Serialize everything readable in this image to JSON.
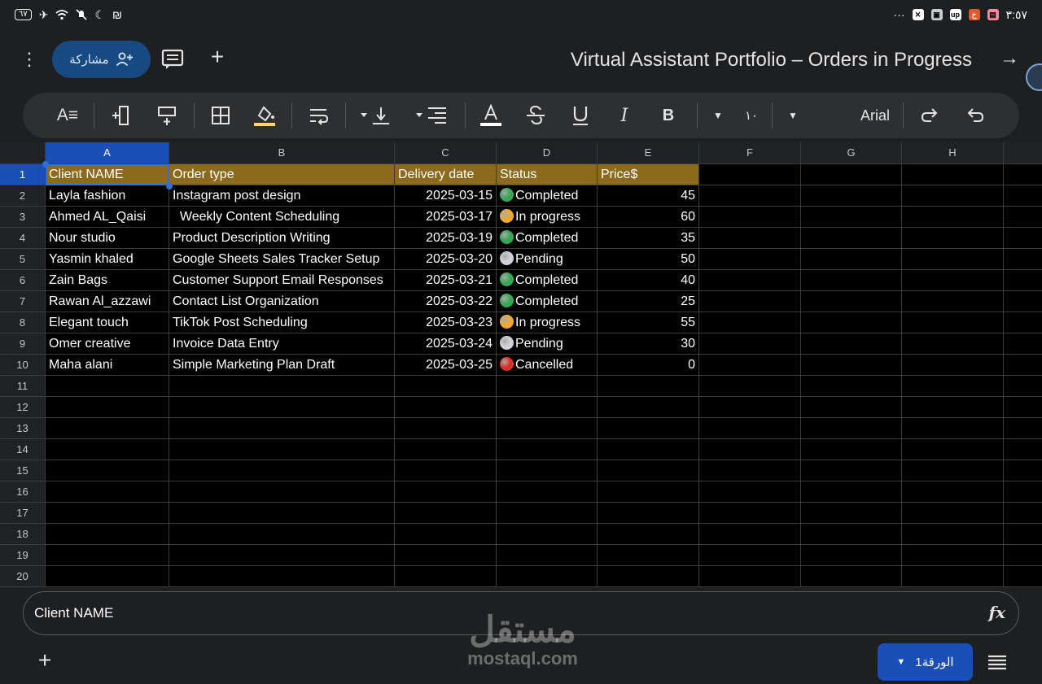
{
  "status_bar": {
    "time": "٣:٥٧",
    "battery": "٦٧",
    "more": "···"
  },
  "topbar": {
    "share_label": "مشاركة",
    "title": "Virtual Assistant Portfolio – Orders in Progress"
  },
  "toolbar": {
    "font_name": "Arial",
    "font_size": "١٠",
    "text_color_underline": "#ffffff",
    "fill_color_underline": "#fdd663"
  },
  "grid": {
    "columns": [
      "A",
      "B",
      "C",
      "D",
      "E",
      "F",
      "G",
      "H"
    ],
    "row_numbers": [
      "1",
      "2",
      "3",
      "4",
      "5",
      "6",
      "7",
      "8",
      "9",
      "10",
      "11",
      "12",
      "13",
      "14",
      "15",
      "16",
      "17",
      "18",
      "19",
      "20"
    ],
    "header": {
      "a": "Client NAME",
      "b": "Order type",
      "c": "Delivery date",
      "d": "Status",
      "e": "Price$"
    },
    "rows": [
      {
        "client": "Layla fashion",
        "order": "Instagram post design",
        "date": "2025-03-15",
        "status": "Completed",
        "price": "45"
      },
      {
        "client": "Ahmed AL_Qaisi",
        "order": "  Weekly Content Scheduling",
        "date": "2025-03-17",
        "status": "In progress",
        "price": "60"
      },
      {
        "client": "Nour studio",
        "order": "Product Description Writing",
        "date": "2025-03-19",
        "status": "Completed",
        "price": "35"
      },
      {
        "client": "Yasmin khaled",
        "order": "Google Sheets Sales Tracker Setup",
        "date": "2025-03-20",
        "status": "Pending",
        "price": "50"
      },
      {
        "client": "Zain Bags",
        "order": "Customer Support Email Responses",
        "date": "2025-03-21",
        "status": "Completed",
        "price": "40"
      },
      {
        "client": "Rawan Al_azzawi",
        "order": "Contact List Organization",
        "date": "2025-03-22",
        "status": "Completed",
        "price": "25"
      },
      {
        "client": "Elegant touch",
        "order": "TikTok Post Scheduling",
        "date": "2025-03-23",
        "status": "In progress",
        "price": "55"
      },
      {
        "client": "Omer creative",
        "order": "Invoice Data Entry",
        "date": "2025-03-24",
        "status": "Pending",
        "price": "30"
      },
      {
        "client": "Maha alani",
        "order": "Simple Marketing Plan Draft",
        "date": "2025-03-25",
        "status": "Cancelled",
        "price": "0"
      }
    ],
    "status_colors": {
      "Completed": "#34a853",
      "In progress": "#f0a830",
      "Pending": "#d0d0d8",
      "Cancelled": "#d93025"
    },
    "header_color": "#8b6a1c",
    "selection_color": "#1a4fb8"
  },
  "formula_bar": {
    "value": "Client NAME",
    "fx_label": "fx"
  },
  "bottom": {
    "sheet_tab_label": "الورقة1"
  },
  "watermark": {
    "arabic": "مستقل",
    "latin": "mostaql.com"
  }
}
